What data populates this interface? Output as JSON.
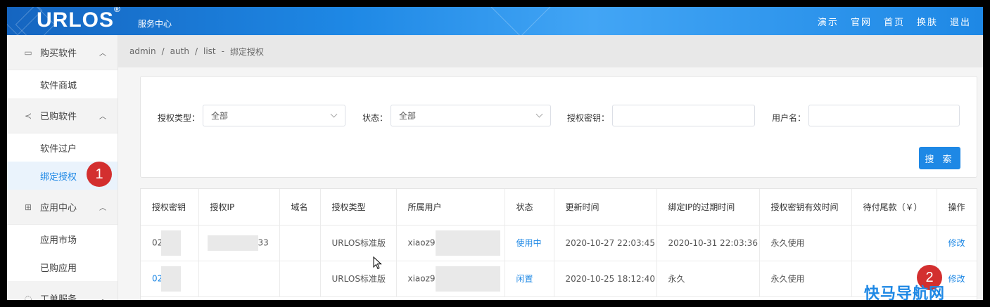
{
  "header": {
    "logo": "URLOS",
    "logo_mark": "®",
    "subtitle": "服务中心",
    "nav": [
      "演示",
      "官网",
      "首页",
      "换肤",
      "退出"
    ]
  },
  "sidebar": {
    "groups": [
      {
        "icon": "shop-icon",
        "label": "购买软件",
        "items": [
          "软件商城"
        ]
      },
      {
        "icon": "share-icon",
        "label": "已购软件",
        "items": [
          "软件过户",
          "绑定授权"
        ]
      },
      {
        "icon": "grid-icon",
        "label": "应用中心",
        "items": [
          "应用市场",
          "已购应用"
        ]
      },
      {
        "icon": "headset-icon",
        "label": "工单服务",
        "items": []
      }
    ],
    "active_item": "绑定授权"
  },
  "breadcrumb": [
    "admin",
    "/",
    "auth",
    "/",
    "list",
    "-",
    "绑定授权"
  ],
  "filters": {
    "license_type_label": "授权类型：",
    "license_type_value": "全部",
    "status_label": "状态：",
    "status_value": "全部",
    "key_label": "授权密钥：",
    "key_value": "",
    "username_label": "用户名：",
    "username_value": "",
    "search_button": "搜 索"
  },
  "table": {
    "headers": [
      "授权密钥",
      "授权IP",
      "域名",
      "授权类型",
      "所属用户",
      "状态",
      "更新时间",
      "绑定IP的过期时间",
      "授权密钥有效时间",
      "待付尾款（￥）",
      "操作"
    ],
    "rows": [
      {
        "key": "02",
        "ip": "33",
        "domain": "",
        "type": "URLOS标准版",
        "user": "xiaoz9",
        "status": "使用中",
        "updated": "2020-10-27 22:03:45",
        "ip_expire": "2020-10-31 22:03:36",
        "valid": "永久使用",
        "balance": "",
        "action": "修改"
      },
      {
        "key": "02",
        "ip": "",
        "domain": "",
        "type": "URLOS标准版",
        "user": "xiaoz9",
        "status": "闲置",
        "updated": "2020-10-25 18:12:40",
        "ip_expire": "永久",
        "valid": "永久使用",
        "balance": "",
        "action": "修改"
      }
    ]
  },
  "annotations": {
    "badge1": "1",
    "badge2": "2"
  },
  "watermark": "快马导航网",
  "colors": {
    "accent": "#1e88e5",
    "badge": "#d32f2f"
  }
}
